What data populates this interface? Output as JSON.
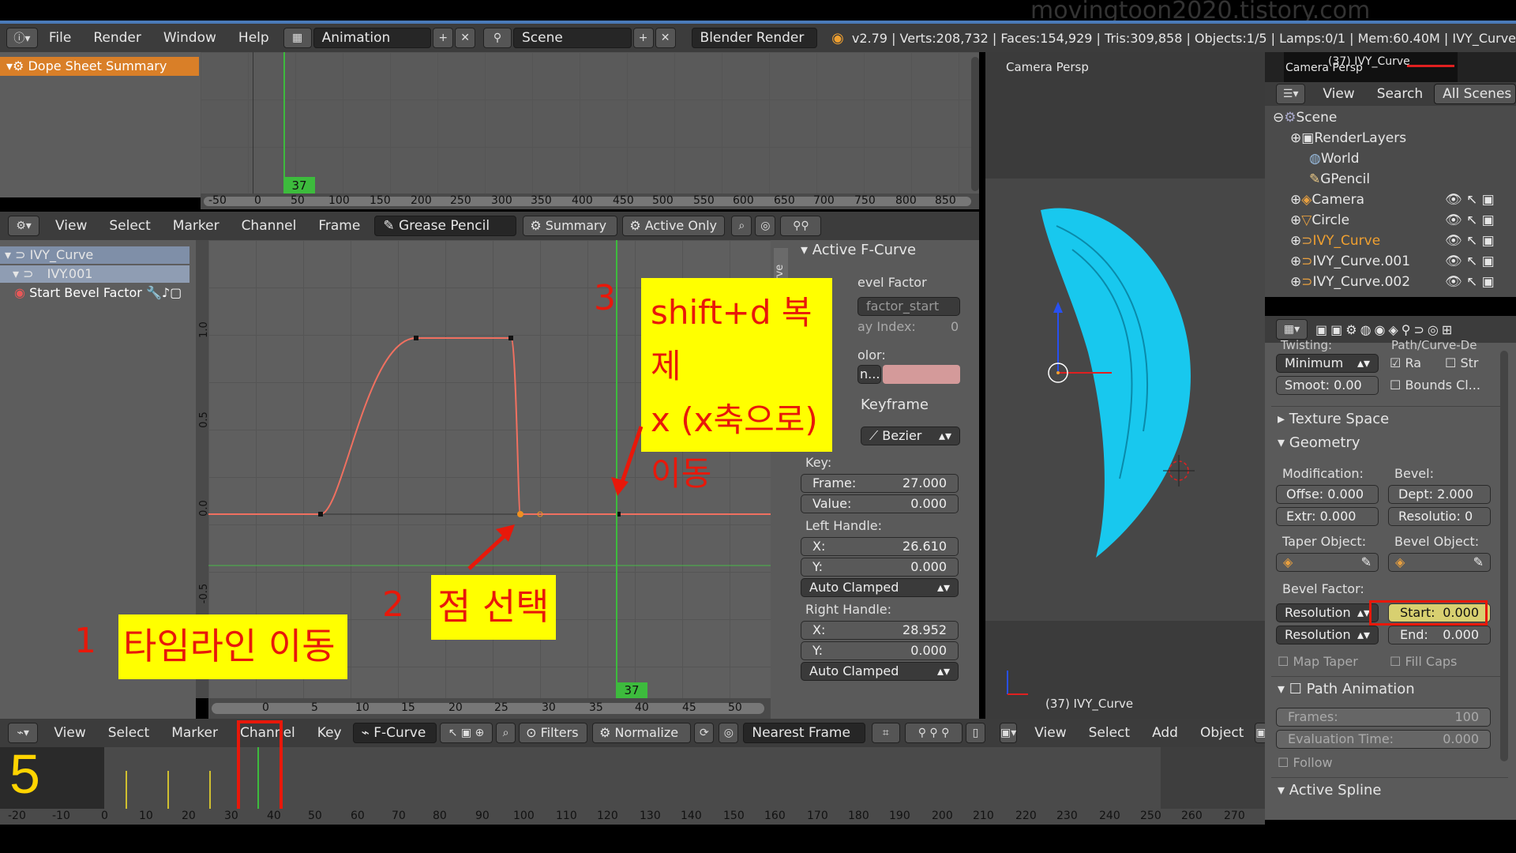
{
  "watermark": "movingtoon2020.tistory.com",
  "info_header": {
    "menus": [
      "File",
      "Render",
      "Window",
      "Help"
    ],
    "layout": "Animation",
    "scene": "Scene",
    "engine": "Blender Render",
    "stats": "v2.79 | Verts:208,732 | Faces:154,929 | Tris:309,858 | Objects:1/5 | Lamps:0/1 | Mem:60.40M | IVY_Curve"
  },
  "dopesheet_summary": {
    "channel": "Dope Sheet Summary",
    "frame_badge": "37",
    "ruler": [
      "-50",
      "0",
      "50",
      "100",
      "150",
      "200",
      "250",
      "300",
      "350",
      "400",
      "450",
      "500",
      "550",
      "600",
      "650",
      "700",
      "750",
      "800",
      "850"
    ]
  },
  "graph_header": {
    "menus": [
      "View",
      "Select",
      "Marker",
      "Channel",
      "Frame"
    ],
    "grease_pencil": "Grease Pencil",
    "summary": "Summary",
    "active_only": "Active Only"
  },
  "graph_channels": {
    "object": "IVY_Curve",
    "data": "IVY.001",
    "fcurve": "Start Bevel Factor"
  },
  "graph_editor": {
    "y_ticks": [
      "1.0",
      "0.5",
      "0.0",
      "-0.5"
    ],
    "x_ticks": [
      "0",
      "5",
      "10",
      "15",
      "20",
      "25",
      "30",
      "35",
      "40",
      "45",
      "50"
    ],
    "frame_badge": "37",
    "curve_keys": [
      {
        "frame": 12,
        "value": 0.0
      },
      {
        "frame": 21,
        "value": 1.0
      },
      {
        "frame": 26.5,
        "value": 1.0
      },
      {
        "frame": 27,
        "value": 0.0
      },
      {
        "frame": 37,
        "value": 0.0
      }
    ]
  },
  "fcurve_panel": {
    "active_fcurve": "Active F-Curve",
    "tab": "urve",
    "fcurve_name": "evel Factor",
    "data_path": "factor_start",
    "array_index_label": "ay Index:",
    "array_index_value": "0",
    "color_label": "olor:",
    "color_mode": "n...",
    "keyframe_header": "Keyframe",
    "interpolation": "Bezier",
    "key_label": "Key:",
    "frame_label": "Frame:",
    "frame_value": "27.000",
    "value_label": "Value:",
    "value_value": "0.000",
    "left_handle": "Left Handle:",
    "lh_x": "26.610",
    "lh_y": "0.000",
    "lh_type": "Auto Clamped",
    "right_handle": "Right Handle:",
    "rh_x": "28.952",
    "rh_y": "0.000",
    "rh_type": "Auto Clamped",
    "x_label": "X:",
    "y_label": "Y:"
  },
  "graph_footer": {
    "menus": [
      "View",
      "Select",
      "Marker",
      "Channel",
      "Key"
    ],
    "mode": "F-Curve",
    "filters": "Filters",
    "normalize": "Normalize",
    "snap": "Nearest Frame"
  },
  "viewport": {
    "label": "Camera Persp",
    "object_label": "(37) IVY_Curve",
    "footer_menus": [
      "View",
      "Select",
      "Add",
      "Object"
    ]
  },
  "camera_preview": {
    "label": "Camera Persp",
    "object": "(37) IVY_Curve"
  },
  "outliner": {
    "menus": [
      "View",
      "Search"
    ],
    "filter": "All Scenes",
    "rows": [
      "Scene",
      "RenderLayers",
      "World",
      "GPencil",
      "Camera",
      "Circle",
      "IVY_Curve",
      "IVY_Curve.001",
      "IVY_Curve.002"
    ]
  },
  "properties": {
    "twisting": "Twisting:",
    "path_curve": "Path/Curve-De",
    "twist_mode": "Minimum",
    "ra": "Ra",
    "str": "Str",
    "smooth": "Smoot: 0.00",
    "bounds": "Bounds Cl...",
    "texture_space": "Texture Space",
    "geometry": "Geometry",
    "modification": "Modification:",
    "bevel": "Bevel:",
    "offset": "Offse: 0.000",
    "depth": "Dept: 2.000",
    "extrude": "Extr:  0.000",
    "resolution": "Resolutio: 0",
    "taper_object": "Taper Object:",
    "bevel_object": "Bevel Object:",
    "bevel_factor": "Bevel Factor:",
    "res1": "Resolution",
    "res2": "Resolution",
    "start_label": "Start:",
    "start_value": "0.000",
    "end_label": "End:",
    "end_value": "0.000",
    "map_taper": "Map Taper",
    "fill_caps": "Fill Caps",
    "path_animation": "Path Animation",
    "frames_label": "Frames:",
    "frames_value": "100",
    "eval_label": "Evaluation Time:",
    "eval_value": "0.000",
    "follow": "Follow",
    "active_spline": "Active Spline"
  },
  "timeline": {
    "frame_number": "5",
    "ruler": [
      "-20",
      "-10",
      "0",
      "10",
      "20",
      "30",
      "40",
      "50",
      "60",
      "70",
      "80",
      "90",
      "100",
      "110",
      "120",
      "130",
      "140",
      "150",
      "160",
      "170",
      "180",
      "190",
      "200",
      "210",
      "220",
      "230",
      "240",
      "250",
      "260",
      "270"
    ]
  },
  "annotations": {
    "n1": "1",
    "n2": "2",
    "n3": "3",
    "note1": "타임라인 이동",
    "note2": "점 선택",
    "note3_l1": "shift+d 복제",
    "note3_l2": "x  (x축으로)",
    "note3_l3": "이동"
  }
}
